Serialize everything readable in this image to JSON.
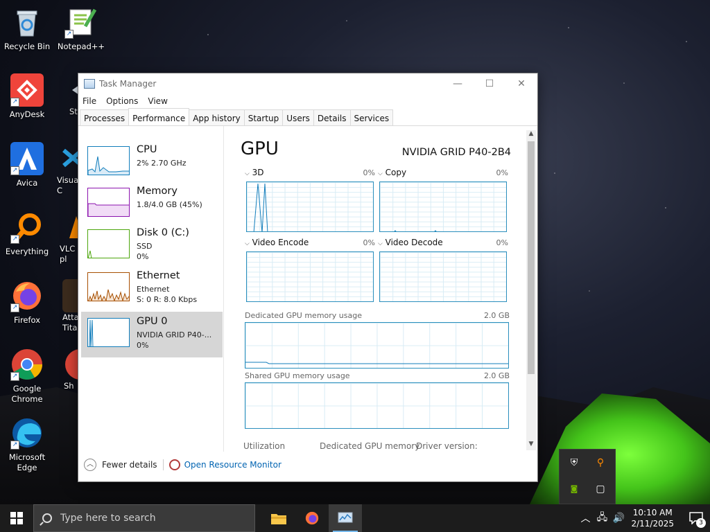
{
  "desktop": {
    "icons": [
      {
        "label": "Recycle Bin"
      },
      {
        "label": "Notepad++"
      },
      {
        "label": "AnyDesk"
      },
      {
        "label": "St"
      },
      {
        "label": "Avica"
      },
      {
        "label": "Visua C"
      },
      {
        "label": "Everything"
      },
      {
        "label": "VLC pl"
      },
      {
        "label": "Firefox"
      },
      {
        "label": "Atta Tita"
      },
      {
        "label": "Google Chrome"
      },
      {
        "label": "Sh"
      },
      {
        "label": "Microsoft Edge"
      }
    ]
  },
  "window": {
    "title": "Task Manager",
    "menu": [
      "File",
      "Options",
      "View"
    ],
    "tabs": [
      "Processes",
      "Performance",
      "App history",
      "Startup",
      "Users",
      "Details",
      "Services"
    ],
    "active_tab": "Performance",
    "sidebar": [
      {
        "name": "CPU",
        "line1": "2% 2.70 GHz",
        "line2": "",
        "color": "#117dbb"
      },
      {
        "name": "Memory",
        "line1": "1.8/4.0 GB (45%)",
        "line2": "",
        "color": "#8b12ae"
      },
      {
        "name": "Disk 0 (C:)",
        "line1": "SSD",
        "line2": "0%",
        "color": "#4da60c"
      },
      {
        "name": "Ethernet",
        "line1": "Ethernet",
        "line2": "S: 0 R: 8.0 Kbps",
        "color": "#a74f01"
      },
      {
        "name": "GPU 0",
        "line1": "NVIDIA GRID P40-...",
        "line2": "0%",
        "color": "#117dbb"
      }
    ],
    "main": {
      "title": "GPU",
      "model": "NVIDIA GRID P40-2B4",
      "graphs": [
        {
          "label": "3D",
          "percent": "0%"
        },
        {
          "label": "Copy",
          "percent": "0%"
        },
        {
          "label": "Video Encode",
          "percent": "0%"
        },
        {
          "label": "Video Decode",
          "percent": "0%"
        }
      ],
      "dedicated_label": "Dedicated GPU memory usage",
      "dedicated_max": "2.0 GB",
      "shared_label": "Shared GPU memory usage",
      "shared_max": "2.0 GB",
      "stats": {
        "utilization": "Utilization",
        "dedicated": "Dedicated GPU memory",
        "driver": "Driver version:"
      }
    },
    "footer": {
      "fewer_details": "Fewer details",
      "open_monitor": "Open Resource Monitor"
    }
  },
  "taskbar": {
    "search_placeholder": "Type here to search",
    "time": "10:10 AM",
    "date": "2/11/2025",
    "notification_count": "3"
  }
}
